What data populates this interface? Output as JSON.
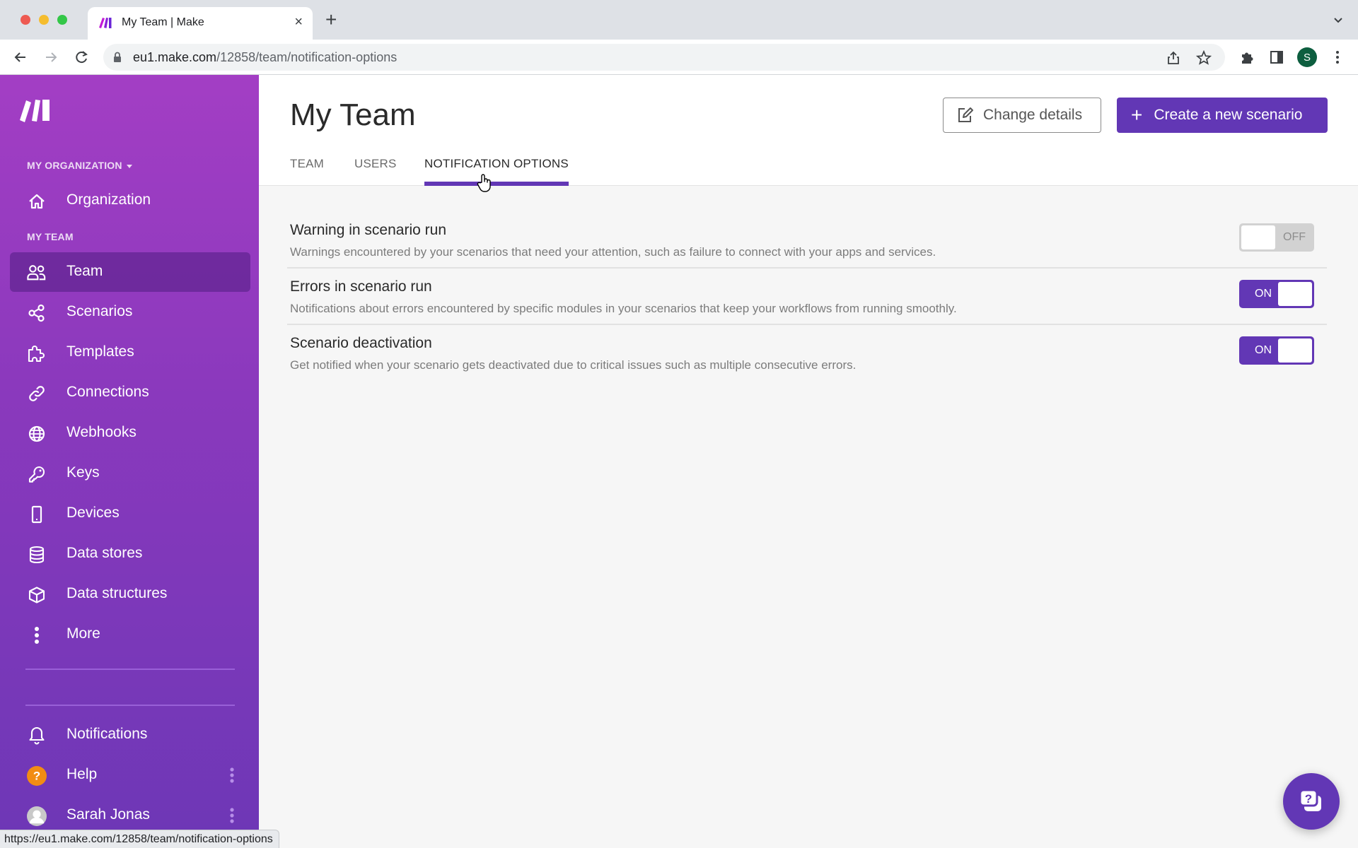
{
  "browser": {
    "tab_title": "My Team | Make",
    "url_host": "eu1.make.com",
    "url_path": "/12858/team/notification-options",
    "profile_initial": "S",
    "status_bar_url": "https://eu1.make.com/12858/team/notification-options"
  },
  "sidebar": {
    "org_section_label": "MY ORGANIZATION",
    "team_section_label": "MY TEAM",
    "org_item": {
      "label": "Organization",
      "icon": "home-icon"
    },
    "items": [
      {
        "label": "Team",
        "icon": "team-icon",
        "active": true
      },
      {
        "label": "Scenarios",
        "icon": "share-nodes-icon"
      },
      {
        "label": "Templates",
        "icon": "puzzle-icon"
      },
      {
        "label": "Connections",
        "icon": "link-icon"
      },
      {
        "label": "Webhooks",
        "icon": "globe-icon"
      },
      {
        "label": "Keys",
        "icon": "key-icon"
      },
      {
        "label": "Devices",
        "icon": "mobile-device-icon"
      },
      {
        "label": "Data stores",
        "icon": "database-icon"
      },
      {
        "label": "Data structures",
        "icon": "cube-icon"
      },
      {
        "label": "More",
        "icon": "vertical-dots-icon"
      }
    ],
    "bottom_items": [
      {
        "label": "Notifications",
        "icon": "bell-icon"
      },
      {
        "label": "Help",
        "icon": "help-circle-icon"
      },
      {
        "label": "Sarah Jonas",
        "icon": "avatar"
      }
    ]
  },
  "header": {
    "title": "My Team",
    "change_details_label": "Change details",
    "create_scenario_label": "Create a new scenario",
    "tabs": [
      {
        "label": "TEAM",
        "active": false
      },
      {
        "label": "USERS",
        "active": false
      },
      {
        "label": "NOTIFICATION OPTIONS",
        "active": true
      }
    ]
  },
  "notifications": [
    {
      "title": "Warning in scenario run",
      "description": "Warnings encountered by your scenarios that need your attention, such as failure to connect with your apps and services.",
      "enabled": false,
      "state_label": "OFF"
    },
    {
      "title": "Errors in scenario run",
      "description": "Notifications about errors encountered by specific modules in your scenarios that keep your workflows from running smoothly.",
      "enabled": true,
      "state_label": "ON"
    },
    {
      "title": "Scenario deactivation",
      "description": "Get notified when your scenario gets deactivated due to critical issues such as multiple consecutive errors.",
      "enabled": true,
      "state_label": "ON"
    }
  ],
  "colors": {
    "accent": "#6237b5",
    "sidebar_top": "#a33ec4",
    "sidebar_bottom": "#6d37b6",
    "help_badge": "#f28c13"
  }
}
